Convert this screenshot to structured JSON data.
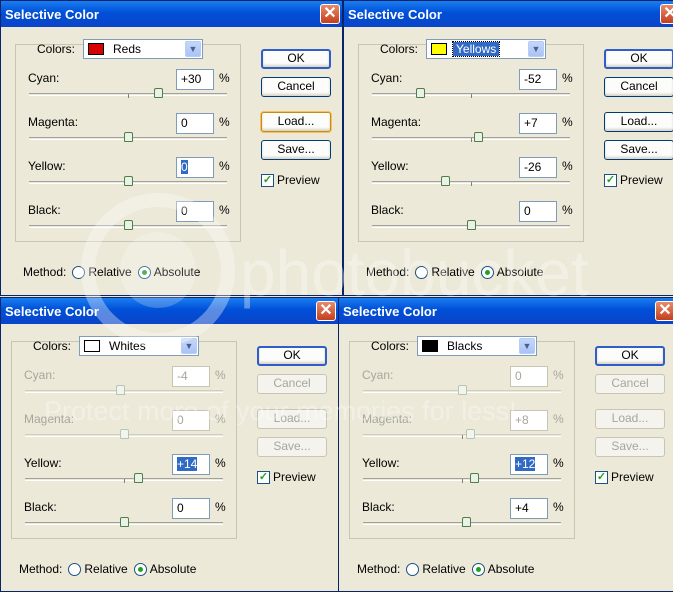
{
  "dialogs": [
    {
      "title": "Selective Color",
      "colors_label": "Colors:",
      "color_name": "Reds",
      "swatch": "#d90000",
      "focused_select": false,
      "sliders": [
        {
          "label": "Cyan:",
          "value": "+30",
          "pct": "%",
          "level": 0.65,
          "highlight": false
        },
        {
          "label": "Magenta:",
          "value": "0",
          "pct": "%",
          "level": 0.5,
          "highlight": false
        },
        {
          "label": "Yellow:",
          "value": "0",
          "pct": "%",
          "level": 0.5,
          "highlight": true
        },
        {
          "label": "Black:",
          "value": "0",
          "pct": "%",
          "level": 0.5,
          "highlight": false
        }
      ],
      "buttons": {
        "ok": "OK",
        "cancel": "Cancel",
        "load": "Load...",
        "save": "Save..."
      },
      "preview": "Preview",
      "method_label": "Method:",
      "relative": "Relative",
      "absolute": "Absolute"
    },
    {
      "title": "Selective Color",
      "colors_label": "Colors:",
      "color_name": "Yellows",
      "swatch": "#ffff00",
      "focused_select": true,
      "sliders": [
        {
          "label": "Cyan:",
          "value": "-52",
          "pct": "%",
          "level": 0.24,
          "highlight": false
        },
        {
          "label": "Magenta:",
          "value": "+7",
          "pct": "%",
          "level": 0.535,
          "highlight": false
        },
        {
          "label": "Yellow:",
          "value": "-26",
          "pct": "%",
          "level": 0.37,
          "highlight": false
        },
        {
          "label": "Black:",
          "value": "0",
          "pct": "%",
          "level": 0.5,
          "highlight": false
        }
      ],
      "buttons": {
        "ok": "OK",
        "cancel": "Cancel",
        "load": "Load...",
        "save": "Save..."
      },
      "preview": "Preview",
      "method_label": "Method:",
      "relative": "Relative",
      "absolute": "Absolute"
    },
    {
      "title": "Selective Color",
      "colors_label": "Colors:",
      "color_name": "Whites",
      "swatch": "#ffffff",
      "focused_select": false,
      "sliders": [
        {
          "label": "Cyan:",
          "value": "-4",
          "pct": "%",
          "level": 0.48,
          "highlight": false
        },
        {
          "label": "Magenta:",
          "value": "0",
          "pct": "%",
          "level": 0.5,
          "highlight": false
        },
        {
          "label": "Yellow:",
          "value": "+14",
          "pct": "%",
          "level": 0.57,
          "highlight": true
        },
        {
          "label": "Black:",
          "value": "0",
          "pct": "%",
          "level": 0.5,
          "highlight": false
        }
      ],
      "buttons": {
        "ok": "OK",
        "cancel": "Cancel",
        "load": "Load...",
        "save": "Save..."
      },
      "preview": "Preview",
      "method_label": "Method:",
      "relative": "Relative",
      "absolute": "Absolute"
    },
    {
      "title": "Selective Color",
      "colors_label": "Colors:",
      "color_name": "Blacks",
      "swatch": "#000000",
      "focused_select": false,
      "sliders": [
        {
          "label": "Cyan:",
          "value": "0",
          "pct": "%",
          "level": 0.5,
          "highlight": false
        },
        {
          "label": "Magenta:",
          "value": "+8",
          "pct": "%",
          "level": 0.54,
          "highlight": false
        },
        {
          "label": "Yellow:",
          "value": "+12",
          "pct": "%",
          "level": 0.56,
          "highlight": true
        },
        {
          "label": "Black:",
          "value": "+4",
          "pct": "%",
          "level": 0.52,
          "highlight": false
        }
      ],
      "buttons": {
        "ok": "OK",
        "cancel": "Cancel",
        "load": "Load...",
        "save": "Save..."
      },
      "preview": "Preview",
      "method_label": "Method:",
      "relative": "Relative",
      "absolute": "Absolute"
    }
  ],
  "watermark": {
    "brand": "photobucket",
    "tagline": "Protect more of your memories for less!"
  }
}
